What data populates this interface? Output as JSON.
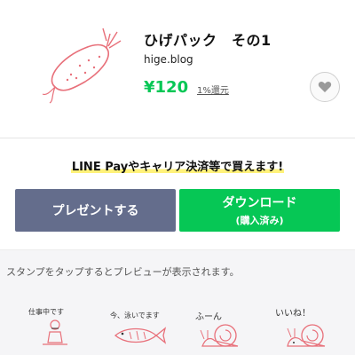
{
  "product": {
    "title": "ひげパック　その1",
    "author": "hige.blog",
    "price": "¥120",
    "rebate": "1%還元",
    "favorite_icon": "heart-icon",
    "main_image": "shrimp-tempura-sticker"
  },
  "promo": {
    "text": "LINE Payやキャリア決済等で買えます!"
  },
  "buttons": {
    "gift_label": "プレゼントする",
    "download_label": "ダウンロード",
    "download_sub": "(購入済み)"
  },
  "preview": {
    "hint": "スタンプをタップするとプレビューが表示されます。",
    "stickers": [
      {
        "text": "仕事中です",
        "image": "worker-sticker"
      },
      {
        "text": "今、泳いでます",
        "image": "fish-sticker"
      },
      {
        "text": "ふーん",
        "image": "snail-sticker"
      },
      {
        "text": "いいね！",
        "image": "snail-like-sticker"
      }
    ]
  },
  "colors": {
    "line_green": "#06c755",
    "gift_gray": "#646d8c",
    "highlight_yellow": "#fff27a",
    "sketch_red": "#e8707a"
  }
}
